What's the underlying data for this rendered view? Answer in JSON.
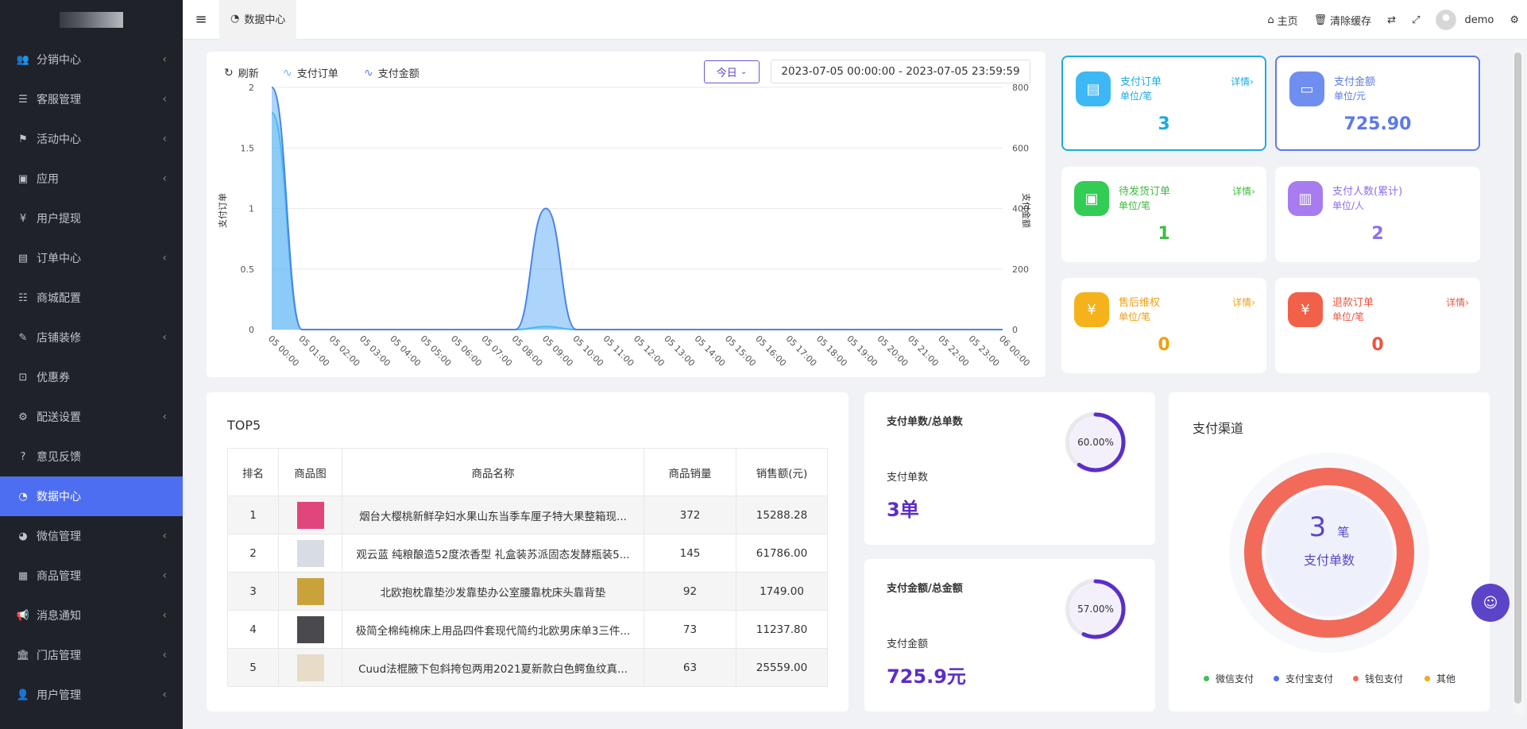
{
  "sidebar": {
    "items": [
      {
        "label": "分销中心",
        "icon": "users-icon",
        "glyph": "👥",
        "chevron": true
      },
      {
        "label": "客服管理",
        "icon": "list-icon",
        "glyph": "☰",
        "chevron": true
      },
      {
        "label": "活动中心",
        "icon": "flag-icon",
        "glyph": "⚑",
        "chevron": true
      },
      {
        "label": "应用",
        "icon": "briefcase-icon",
        "glyph": "▣",
        "chevron": true
      },
      {
        "label": "用户提现",
        "icon": "yen-icon",
        "glyph": "¥",
        "chevron": false
      },
      {
        "label": "订单中心",
        "icon": "file-icon",
        "glyph": "▤",
        "chevron": true
      },
      {
        "label": "商城配置",
        "icon": "sliders-icon",
        "glyph": "☷",
        "chevron": false
      },
      {
        "label": "店铺装修",
        "icon": "brush-icon",
        "glyph": "✎",
        "chevron": true
      },
      {
        "label": "优惠券",
        "icon": "coupon-icon",
        "glyph": "⊡",
        "chevron": false
      },
      {
        "label": "配送设置",
        "icon": "cogs-icon",
        "glyph": "⚙",
        "chevron": true
      },
      {
        "label": "意见反馈",
        "icon": "question-icon",
        "glyph": "?",
        "chevron": false
      },
      {
        "label": "数据中心",
        "icon": "dashboard-icon",
        "glyph": "◔",
        "chevron": false,
        "active": true
      },
      {
        "label": "微信管理",
        "icon": "wechat-icon",
        "glyph": "◕",
        "chevron": true
      },
      {
        "label": "商品管理",
        "icon": "archive-icon",
        "glyph": "▦",
        "chevron": true
      },
      {
        "label": "消息通知",
        "icon": "bullhorn-icon",
        "glyph": "📢",
        "chevron": true
      },
      {
        "label": "门店管理",
        "icon": "bank-icon",
        "glyph": "🏛",
        "chevron": true
      },
      {
        "label": "用户管理",
        "icon": "user-icon",
        "glyph": "👤",
        "chevron": true
      }
    ]
  },
  "header": {
    "tab_label": "数据中心",
    "home_label": "主页",
    "clear_cache_label": "清除缓存",
    "username": "demo"
  },
  "chart_panel": {
    "refresh_label": "刷新",
    "date_select": "今日",
    "date_range": "2023-07-05 00:00:00  -  2023-07-05 23:59:59"
  },
  "chart_data": {
    "type": "area",
    "categories": [
      "05 00:00",
      "05 01:00",
      "05 02:00",
      "05 03:00",
      "05 04:00",
      "05 05:00",
      "05 06:00",
      "05 07:00",
      "05 08:00",
      "05 09:00",
      "05 10:00",
      "05 11:00",
      "05 12:00",
      "05 13:00",
      "05 14:00",
      "05 15:00",
      "05 16:00",
      "05 17:00",
      "05 18:00",
      "05 19:00",
      "05 20:00",
      "05 21:00",
      "05 22:00",
      "05 23:00",
      "06 00:00"
    ],
    "series": [
      {
        "name": "支付订单",
        "axis": "left",
        "color": "#6ab0f5",
        "values": [
          2,
          0,
          0,
          0,
          0,
          0,
          0,
          0,
          0,
          1,
          0,
          0,
          0,
          0,
          0,
          0,
          0,
          0,
          0,
          0,
          0,
          0,
          0,
          0,
          0
        ]
      },
      {
        "name": "支付金额",
        "axis": "right",
        "color": "#29c4e8",
        "values": [
          715.9,
          0,
          0,
          0,
          0,
          0,
          0,
          0,
          0,
          10,
          0,
          0,
          0,
          0,
          0,
          0,
          0,
          0,
          0,
          0,
          0,
          0,
          0,
          0,
          0
        ]
      }
    ],
    "ylabel": "支付订单",
    "ylabel_right": "支付金额",
    "ylim": [
      0,
      2
    ],
    "ylim_right": [
      0,
      800
    ],
    "yticks": [
      "0",
      "0.5",
      "1",
      "1.5",
      "2"
    ],
    "yticks_right": [
      "0",
      "200",
      "400",
      "600",
      "800"
    ],
    "grid": true
  },
  "stats": [
    {
      "title": "支付订单",
      "unit": "单位/笔",
      "value": "3",
      "detail": "详情",
      "color": "#1cabe2",
      "icon_bg": "#3db8f5",
      "icon": "document-icon",
      "glyph": "▤",
      "highlight": true
    },
    {
      "title": "支付金额",
      "unit": "单位/元",
      "value": "725.90",
      "detail": "",
      "color": "#5b7ae8",
      "icon_bg": "#6f8ef0",
      "icon": "wallet-icon",
      "glyph": "▭",
      "highlight": true
    },
    {
      "title": "待发货订单",
      "unit": "单位/笔",
      "value": "1",
      "detail": "详情",
      "color": "#3fba3f",
      "icon_bg": "#33cc55",
      "icon": "box-icon",
      "glyph": "▣",
      "highlight": false
    },
    {
      "title": "支付人数(累计)",
      "unit": "单位/人",
      "value": "2",
      "detail": "",
      "color": "#8e6ef0",
      "icon_bg": "#a67cf0",
      "icon": "bar-chart-icon",
      "glyph": "▥",
      "highlight": false
    },
    {
      "title": "售后维权",
      "unit": "单位/笔",
      "value": "0",
      "detail": "详情",
      "color": "#f0a010",
      "icon_bg": "#f6b21a",
      "icon": "shield-icon",
      "glyph": "¥",
      "highlight": false
    },
    {
      "title": "退款订单",
      "unit": "单位/笔",
      "value": "0",
      "detail": "详情",
      "color": "#f0553e",
      "icon_bg": "#f2604a",
      "icon": "refund-icon",
      "glyph": "¥",
      "highlight": false
    }
  ],
  "top5": {
    "title": "TOP5",
    "headers": [
      "排名",
      "商品图",
      "商品名称",
      "商品销量",
      "销售额(元)"
    ],
    "rows": [
      {
        "rank": "1",
        "name": "烟台大樱桃新鲜孕妇水果山东当季车厘子特大果整箱现...",
        "sales": "372",
        "amount": "15288.28",
        "thumb": "#e0457b"
      },
      {
        "rank": "2",
        "name": "观云蓝 纯粮酿造52度浓香型 礼盒装苏派固态发酵瓶装5...",
        "sales": "145",
        "amount": "61786.00",
        "thumb": "#d8dce4"
      },
      {
        "rank": "3",
        "name": "北欧抱枕靠垫沙发靠垫办公室腰靠枕床头靠背垫",
        "sales": "92",
        "amount": "1749.00",
        "thumb": "#c9a23a"
      },
      {
        "rank": "4",
        "name": "极简全棉纯棉床上用品四件套现代简约北欧男床单3三件...",
        "sales": "73",
        "amount": "11237.80",
        "thumb": "#4a4a4e"
      },
      {
        "rank": "5",
        "name": "Cuud法棍腋下包斜挎包两用2021夏新款白色鳄鱼纹真...",
        "sales": "63",
        "amount": "25559.00",
        "thumb": "#e6dcc8"
      }
    ]
  },
  "ratios": [
    {
      "title": "支付单数/总单数",
      "label": "支付单数",
      "value": "3单",
      "percent_text": "60.00%",
      "percent": 0.6
    },
    {
      "title": "支付金额/总金额",
      "label": "支付金额",
      "value": "725.9元",
      "percent_text": "57.00%",
      "percent": 0.57
    }
  ],
  "payment": {
    "title": "支付渠道",
    "center_value": "3",
    "center_unit": "笔",
    "center_label": "支付单数",
    "legend": [
      {
        "name": "微信支付",
        "color": "#3cc05a"
      },
      {
        "name": "支付宝支付",
        "color": "#4e6ef2"
      },
      {
        "name": "钱包支付",
        "color": "#f26a5a"
      },
      {
        "name": "其他",
        "color": "#f5a623"
      }
    ],
    "ring_color": "#f26a5a"
  }
}
